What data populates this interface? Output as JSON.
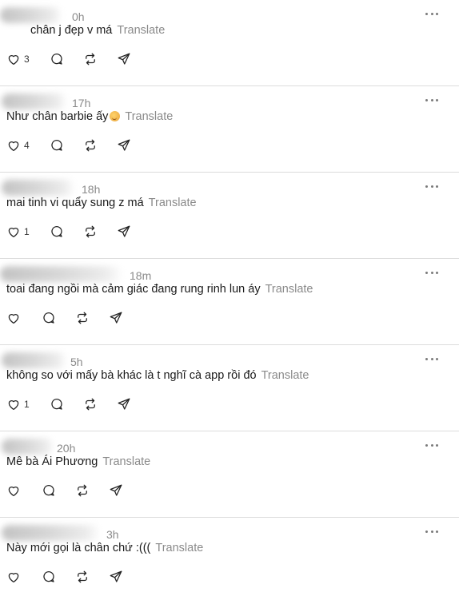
{
  "posts": [
    {
      "time": "0h",
      "text": "chân j đẹp v má",
      "translate": "Translate",
      "likes": "3",
      "has_count": true,
      "emoji": false
    },
    {
      "time": "17h",
      "text": "Như chân barbie ấy",
      "translate": "Translate",
      "likes": "4",
      "has_count": true,
      "emoji": true
    },
    {
      "time": "18h",
      "text": "mai tinh vi quẩy sung z má",
      "translate": "Translate",
      "likes": "1",
      "has_count": true,
      "emoji": false
    },
    {
      "time": "18m",
      "text": "toai đang ngồi mà cảm giác đang rung rinh lun áy",
      "translate": "Translate",
      "likes": "",
      "has_count": false,
      "emoji": false
    },
    {
      "time": "5h",
      "text": "không so với mấy bà khác là t nghĩ cà app rồi đó",
      "translate": "Translate",
      "likes": "1",
      "has_count": true,
      "emoji": false
    },
    {
      "time": "20h",
      "text": "Mê bà Ái Phương",
      "translate": "Translate",
      "likes": "",
      "has_count": false,
      "emoji": false
    },
    {
      "time": "3h",
      "text": "Này mới gọi là chân chứ :(((",
      "translate": "Translate",
      "likes": "",
      "has_count": false,
      "emoji": false
    }
  ],
  "icons": {
    "like": "heart-icon",
    "reply": "reply-bubble-icon",
    "repost": "repost-icon",
    "share": "send-icon",
    "more": "more-options-icon"
  }
}
